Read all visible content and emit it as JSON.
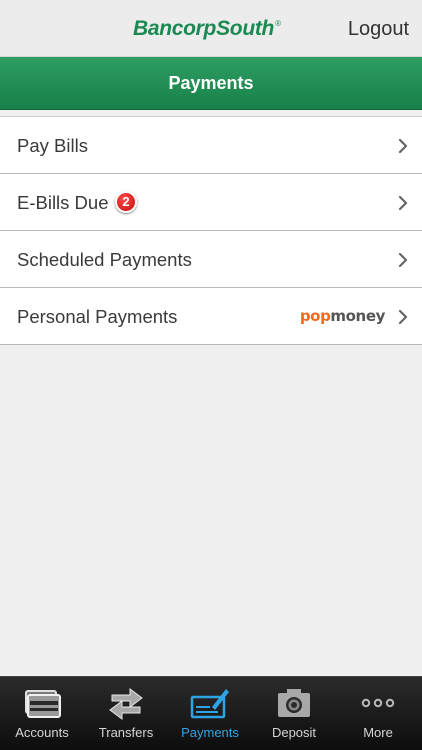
{
  "header": {
    "brand": "BancorpSouth",
    "brand_mark": "®",
    "logout_label": "Logout"
  },
  "titlebar": {
    "title": "Payments"
  },
  "menu": {
    "items": [
      {
        "label": "Pay Bills"
      },
      {
        "label": "E-Bills Due",
        "badge": "2"
      },
      {
        "label": "Scheduled Payments"
      },
      {
        "label": "Personal Payments",
        "partner_pop": "pop",
        "partner_money": "money"
      }
    ]
  },
  "tabs": {
    "items": [
      {
        "label": "Accounts",
        "icon": "wallet-icon"
      },
      {
        "label": "Transfers",
        "icon": "transfer-arrows-icon"
      },
      {
        "label": "Payments",
        "icon": "check-pen-icon",
        "active": true
      },
      {
        "label": "Deposit",
        "icon": "camera-icon"
      },
      {
        "label": "More",
        "icon": "more-dots-icon"
      }
    ]
  },
  "colors": {
    "brand_green": "#1a8a52",
    "title_bar_green": "#18804a",
    "badge_red": "#c40d0d",
    "active_tab_blue": "#2ea4e6",
    "popmoney_orange": "#f06a1f"
  }
}
